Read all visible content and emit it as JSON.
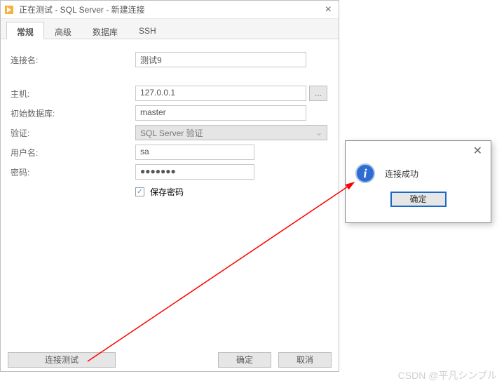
{
  "window": {
    "title": "正在测试 - SQL Server - 新建连接"
  },
  "tabs": {
    "general": "常规",
    "advanced": "高级",
    "database": "数据库",
    "ssh": "SSH"
  },
  "labels": {
    "connection_name": "连接名:",
    "host": "主机:",
    "initial_db": "初始数据库:",
    "auth": "验证:",
    "username": "用户名:",
    "password": "密码:",
    "save_password": "保存密码"
  },
  "values": {
    "connection_name": "测试9",
    "host": "127.0.0.1",
    "initial_db": "master",
    "auth": "SQL Server 验证",
    "username": "sa",
    "password": "●●●●●●●"
  },
  "buttons": {
    "test": "连接测试",
    "ok": "确定",
    "cancel": "取消",
    "browse": "..."
  },
  "popup": {
    "message": "连接成功",
    "ok": "确定",
    "icon": "i"
  },
  "checkbox": {
    "save_password_check": "✓"
  },
  "watermark": "CSDN @平凡シンプル"
}
